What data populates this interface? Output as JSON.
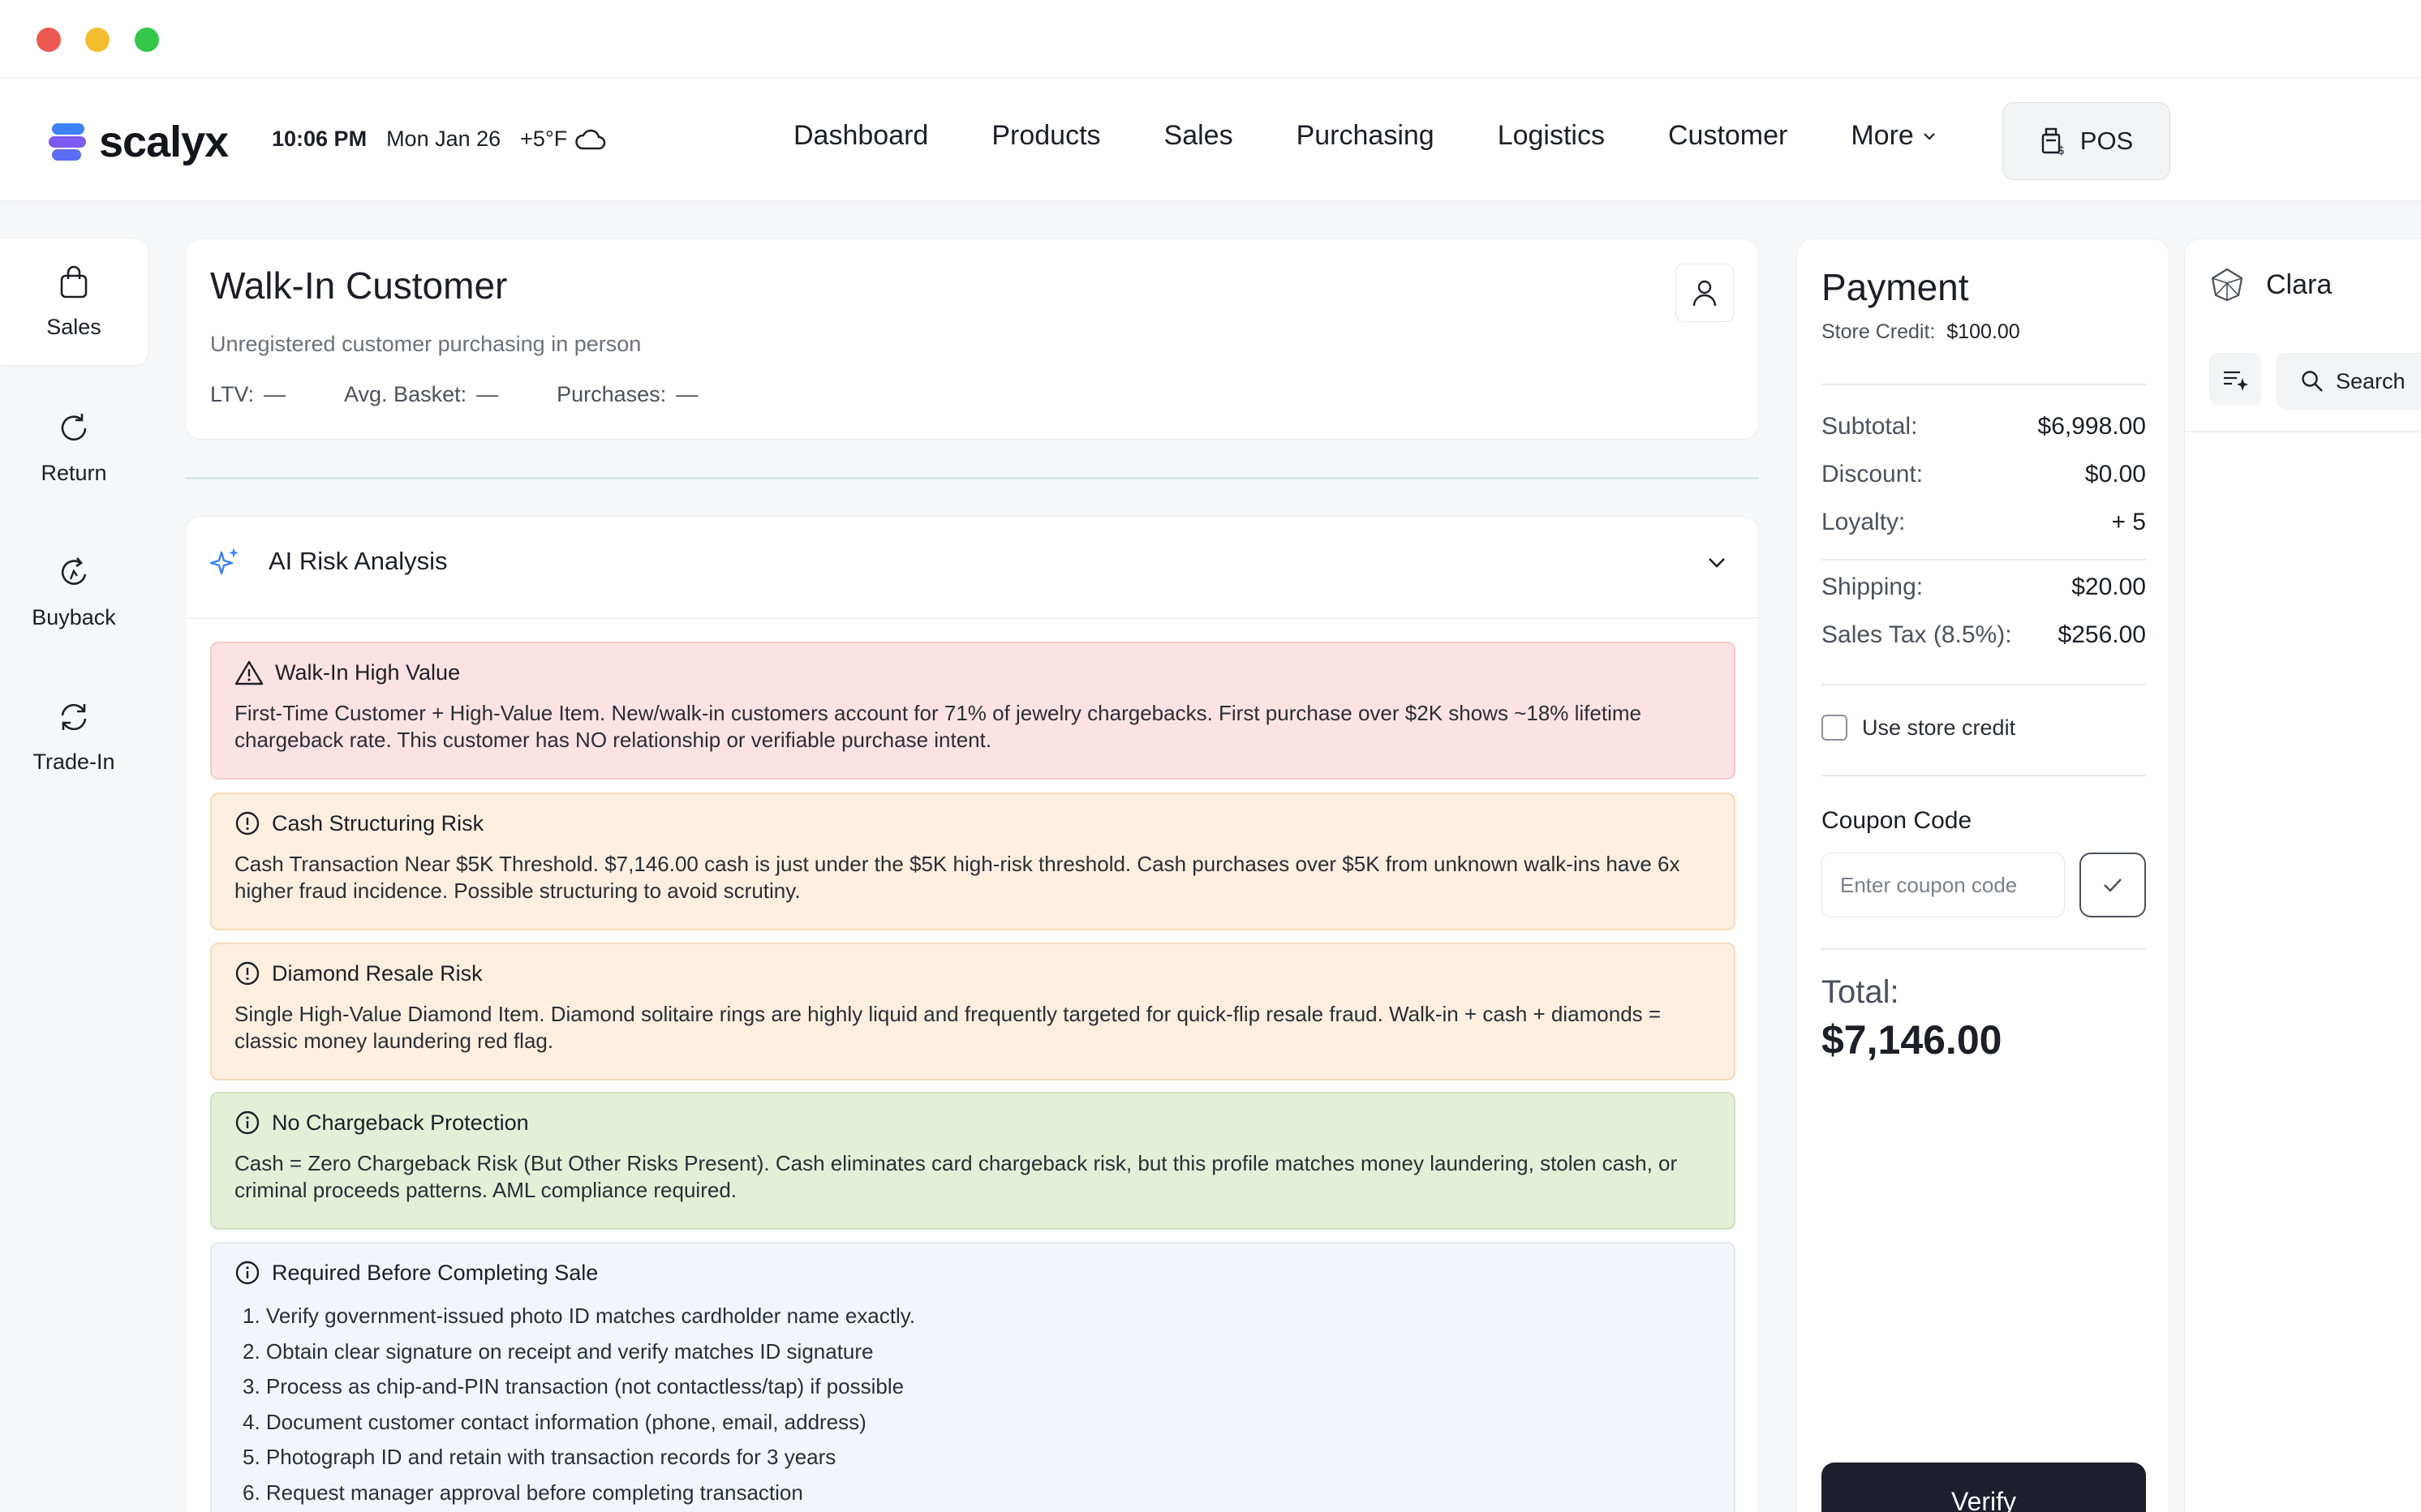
{
  "brand": {
    "name": "scalyx"
  },
  "header": {
    "time": "10:06 PM",
    "date": "Mon Jan 26",
    "temperature": "+5°F",
    "weather_icon": "cloud-icon",
    "nav": [
      "Dashboard",
      "Products",
      "Sales",
      "Purchasing",
      "Logistics",
      "Customer"
    ],
    "more_label": "More",
    "pos_label": "POS"
  },
  "sidebar": {
    "items": [
      {
        "label": "Sales",
        "icon": "shopping-bag-icon",
        "active": true
      },
      {
        "label": "Return",
        "icon": "refresh-icon",
        "active": false
      },
      {
        "label": "Buyback",
        "icon": "buyback-icon",
        "active": false
      },
      {
        "label": "Trade-In",
        "icon": "trade-in-icon",
        "active": false
      }
    ]
  },
  "customer": {
    "name": "Walk-In Customer",
    "subtitle": "Unregistered customer purchasing in person",
    "ltv_label": "LTV:",
    "ltv_value": "—",
    "basket_label": "Avg. Basket:",
    "basket_value": "—",
    "purchases_label": "Purchases:",
    "purchases_value": "—"
  },
  "risk": {
    "title": "AI Risk Analysis",
    "alerts": [
      {
        "level": "red",
        "icon": "warning-triangle-icon",
        "title": "Walk-In High Value",
        "body": "First-Time Customer + High-Value Item. New/walk-in customers account for 71% of jewelry chargebacks. First purchase over $2K shows ~18% lifetime chargeback rate. This customer has NO relationship or verifiable purchase intent."
      },
      {
        "level": "orange",
        "icon": "alert-circle-icon",
        "title": "Cash Structuring Risk",
        "body": "Cash Transaction Near $5K Threshold. $7,146.00 cash is just under the $5K high-risk threshold. Cash purchases over $5K from unknown walk-ins have 6x higher fraud incidence. Possible structuring to avoid scrutiny."
      },
      {
        "level": "orange",
        "icon": "alert-circle-icon",
        "title": "Diamond Resale Risk",
        "body": "Single High-Value Diamond Item. Diamond solitaire rings are highly liquid and frequently targeted for quick-flip resale fraud. Walk-in + cash + diamonds = classic money laundering red flag."
      },
      {
        "level": "green",
        "icon": "info-circle-icon",
        "title": "No Chargeback Protection",
        "body": "Cash = Zero Chargeback Risk (But Other Risks Present). Cash eliminates card chargeback risk, but this profile matches money laundering, stolen cash, or criminal proceeds patterns. AML compliance required."
      }
    ],
    "required": {
      "title": "Required Before Completing Sale",
      "icon": "info-circle-icon",
      "items": [
        "1. Verify government-issued photo ID matches cardholder name exactly.",
        "2. Obtain clear signature on receipt and verify matches ID signature",
        "3. Process as chip-and-PIN transaction (not contactless/tap) if possible",
        "4. Document customer contact information (phone, email, address)",
        "5. Photograph ID and retain with transaction records for 3 years",
        "6. Request manager approval before completing transaction"
      ]
    }
  },
  "payment": {
    "title": "Payment",
    "store_credit_label": "Store Credit:",
    "store_credit_value": "$100.00",
    "subtotal_label": "Subtotal:",
    "subtotal_value": "$6,998.00",
    "discount_label": "Discount:",
    "discount_value": "$0.00",
    "loyalty_label": "Loyalty:",
    "loyalty_value": "+ 5",
    "shipping_label": "Shipping:",
    "shipping_value": "$20.00",
    "tax_label": "Sales Tax (8.5%):",
    "tax_value": "$256.00",
    "use_store_credit_label": "Use store credit",
    "use_store_credit_checked": false,
    "coupon_label": "Coupon Code",
    "coupon_placeholder": "Enter coupon code",
    "coupon_value": "",
    "total_label": "Total:",
    "total_value": "$7,146.00",
    "verify_label": "Verify"
  },
  "assistant": {
    "name": "Clara",
    "search_label": "Search"
  },
  "colors": {
    "alert_red": "#fce3e3",
    "alert_orange": "#fcefe0",
    "alert_green": "#e4efd8",
    "alert_blue": "#f2f6fc",
    "primary_button": "#1e1f2c",
    "accent_blue": "#3b82f6"
  }
}
